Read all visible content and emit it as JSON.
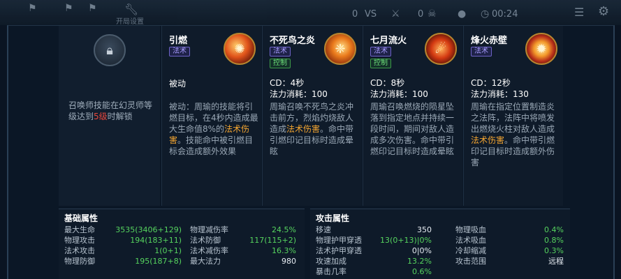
{
  "top_hud": {
    "label": "开局设置",
    "vs": "VS",
    "timer": "00:24",
    "count_a": "0",
    "count_b": "0"
  },
  "lock_panel": {
    "icon": "lock-icon",
    "text_before": "召唤师技能在幻灵师等级达到",
    "text_level": "5级",
    "text_after": "时解锁"
  },
  "skills": [
    {
      "name": "引燃",
      "tags": [
        "法术"
      ],
      "icon": "fire-swirl-icon",
      "type_line": "被动",
      "cd": "",
      "cost": "",
      "desc_parts": [
        "被动：周瑜的技能将引燃目标，在4秒内造成最大生命值8%的",
        "法术伤害",
        "。技能命中被引燃目标会造成额外效果"
      ]
    },
    {
      "name": "不死鸟之炎",
      "tags": [
        "法术",
        "控制"
      ],
      "icon": "phoenix-icon",
      "type_line": "",
      "cd": "CD：4秒",
      "cost": "法力消耗：100",
      "desc_parts": [
        "周瑜召唤不死鸟之炎冲击前方，烈焰灼烧敌人造成",
        "法术伤害",
        "。命中带引燃印记目标时造成晕眩"
      ]
    },
    {
      "name": "七月流火",
      "tags": [
        "法术",
        "控制"
      ],
      "icon": "meteor-icon",
      "type_line": "",
      "cd": "CD：8秒",
      "cost": "法力消耗：100",
      "desc_parts": [
        "周瑜召唤燃烧的陨星坠落到指定地点并持续一段时间，期间对敌人造成多次伤害。命中带引燃印记目标时造成晕眩",
        "",
        ""
      ]
    },
    {
      "name": "烽火赤壁",
      "tags": [
        "法术"
      ],
      "icon": "fire-ring-icon",
      "type_line": "",
      "cd": "CD：12秒",
      "cost": "法力消耗：130",
      "desc_parts": [
        "周瑜在指定位置制造炎之法阵，法阵中将喷发出燃烧火柱对敌人造成",
        "法术伤害",
        "。命中带引燃印记目标时造成额外伤害"
      ]
    }
  ],
  "basic_attrs": {
    "title": "基础属性",
    "left": [
      {
        "label": "最大生命",
        "value": "3535(3406+129)"
      },
      {
        "label": "物理攻击",
        "value": "194(183+11)"
      },
      {
        "label": "法术攻击",
        "value": "1(0+1)"
      },
      {
        "label": "物理防御",
        "value": "195(187+8)"
      }
    ],
    "right": [
      {
        "label": "物理减伤率",
        "value": "24.5%"
      },
      {
        "label": "法术防御",
        "value": "117(115+2)"
      },
      {
        "label": "法术减伤率",
        "value": "16.3%"
      },
      {
        "label": "最大法力",
        "value": "980"
      }
    ]
  },
  "attack_attrs": {
    "title": "攻击属性",
    "left": [
      {
        "label": "移速",
        "value": "350"
      },
      {
        "label": "物理护甲穿透",
        "value": "13(0+13)|0%"
      },
      {
        "label": "法术护甲穿透",
        "value": "0|0%"
      },
      {
        "label": "攻速加成",
        "value": "13.2%"
      },
      {
        "label": "暴击几率",
        "value": "0.6%"
      }
    ],
    "right": [
      {
        "label": "物理吸血",
        "value": "0.4%"
      },
      {
        "label": "法术吸血",
        "value": "0.8%"
      },
      {
        "label": "冷却缩减",
        "value": "0.3%"
      },
      {
        "label": "攻击范围",
        "value": "远程"
      }
    ]
  },
  "colors": {
    "highlight_red": "#e6473c",
    "highlight_orange": "#f3a531",
    "stat_green": "#56d45e",
    "tag_magic": "#a89cff",
    "tag_control": "#6ee07a"
  }
}
